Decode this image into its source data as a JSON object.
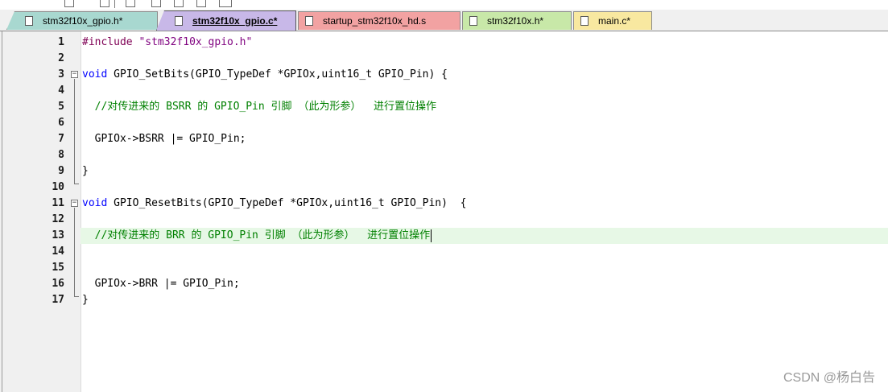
{
  "tabs": [
    {
      "label": "stm32f10x_gpio.h*",
      "color": "#a8d8d0",
      "active": false
    },
    {
      "label": "stm32f10x_gpio.c*",
      "color": "#c8b8e8",
      "active": true
    },
    {
      "label": "startup_stm32f10x_hd.s",
      "color": "#f2a2a2",
      "active": false
    },
    {
      "label": "stm32f10x.h*",
      "color": "#c8e8a8",
      "active": false
    },
    {
      "label": "main.c*",
      "color": "#f8e8a0",
      "active": false
    }
  ],
  "lines": [
    {
      "num": "1",
      "segments": [
        {
          "t": "#include ",
          "c": "pre"
        },
        {
          "t": "\"stm32f10x_gpio.h\"",
          "c": "str"
        }
      ]
    },
    {
      "num": "2",
      "segments": []
    },
    {
      "num": "3",
      "segments": [
        {
          "t": "void",
          "c": "kw"
        },
        {
          "t": " GPIO_SetBits(GPIO_TypeDef *GPIOx,uint16_t GPIO_Pin) {",
          "c": ""
        }
      ]
    },
    {
      "num": "4",
      "segments": []
    },
    {
      "num": "5",
      "segments": [
        {
          "t": "  //对传进来的 BSRR 的 GPIO_Pin 引脚 （此为形参）  进行置位操作",
          "c": "cmt"
        }
      ]
    },
    {
      "num": "6",
      "segments": []
    },
    {
      "num": "7",
      "segments": [
        {
          "t": "  GPIOx->BSRR |= GPIO_Pin;",
          "c": ""
        }
      ]
    },
    {
      "num": "8",
      "segments": []
    },
    {
      "num": "9",
      "segments": [
        {
          "t": "}",
          "c": ""
        }
      ]
    },
    {
      "num": "10",
      "segments": []
    },
    {
      "num": "11",
      "segments": [
        {
          "t": "void",
          "c": "kw"
        },
        {
          "t": " GPIO_ResetBits(GPIO_TypeDef *GPIOx,uint16_t GPIO_Pin)  {",
          "c": ""
        }
      ]
    },
    {
      "num": "12",
      "segments": []
    },
    {
      "num": "13",
      "segments": [
        {
          "t": "  //对传进来的 BRR 的 GPIO_Pin 引脚 （此为形参）  进行置位操作",
          "c": "cmt"
        }
      ]
    },
    {
      "num": "14",
      "segments": []
    },
    {
      "num": "15",
      "segments": []
    },
    {
      "num": "16",
      "segments": [
        {
          "t": "  GPIOx->BRR |= GPIO_Pin;",
          "c": ""
        }
      ]
    },
    {
      "num": "17",
      "segments": [
        {
          "t": "}",
          "c": ""
        }
      ]
    }
  ],
  "current_line": "13",
  "watermark": "CSDN @杨白告"
}
